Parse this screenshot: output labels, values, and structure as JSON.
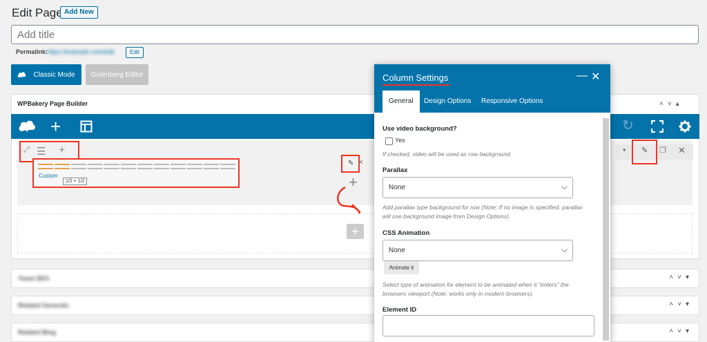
{
  "header": {
    "page_title": "Edit Page",
    "add_new_label": "Add New",
    "title_placeholder": "Add title",
    "permalink_label": "Permalink:",
    "permalink_url": "https://example.com/edit",
    "permalink_edit_label": "Edit",
    "classic_mode_label": "Classic Mode",
    "gutenberg_label": "Gutenberg Editor"
  },
  "builder": {
    "title": "WPBakery Page Builder",
    "custom_label": "Custom",
    "layout_tooltip": "1/2 + 1/2",
    "column_plus": "+",
    "bottom_plus": "+",
    "toolbar_icons": [
      "logo-icon",
      "plus-icon",
      "layout-icon",
      "redo-icon",
      "fullscreen-icon",
      "gear-icon"
    ]
  },
  "meta_boxes": [
    {
      "title": "Yoast SEO"
    },
    {
      "title": "Related Generals"
    },
    {
      "title": "Related Blog"
    }
  ],
  "modal": {
    "title": "Column Settings",
    "tabs": [
      {
        "label": "General"
      },
      {
        "label": "Design Options"
      },
      {
        "label": "Responsive Options"
      }
    ],
    "video_bg_label": "Use video background?",
    "video_bg_yes": "Yes",
    "video_bg_hint": "If checked, video will be used as row background.",
    "parallax_label": "Parallax",
    "parallax_value": "None",
    "parallax_hint": "Add parallax type background for row (Note: If no image is specified, parallax will use background image from Design Options).",
    "css_anim_label": "CSS Animation",
    "css_anim_value": "None",
    "animate_btn": "Animate it",
    "css_anim_hint": "Select type of animation for element to be animated when it \"enters\" the browsers viewport (Note: works only in modern browsers).",
    "element_id_label": "Element ID"
  },
  "colors": {
    "accent": "#0473aa",
    "highlight": "#ee3322"
  }
}
